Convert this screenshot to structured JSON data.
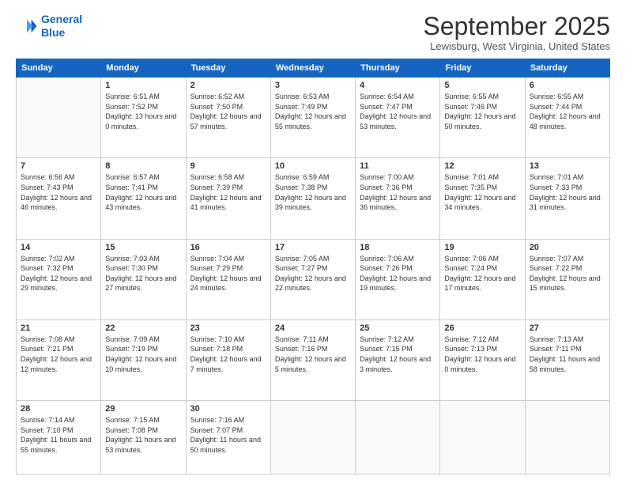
{
  "logo": {
    "line1": "General",
    "line2": "Blue"
  },
  "title": "September 2025",
  "location": "Lewisburg, West Virginia, United States",
  "days_header": [
    "Sunday",
    "Monday",
    "Tuesday",
    "Wednesday",
    "Thursday",
    "Friday",
    "Saturday"
  ],
  "weeks": [
    [
      {
        "day": "",
        "sunrise": "",
        "sunset": "",
        "daylight": ""
      },
      {
        "day": "1",
        "sunrise": "Sunrise: 6:51 AM",
        "sunset": "Sunset: 7:52 PM",
        "daylight": "Daylight: 13 hours and 0 minutes."
      },
      {
        "day": "2",
        "sunrise": "Sunrise: 6:52 AM",
        "sunset": "Sunset: 7:50 PM",
        "daylight": "Daylight: 12 hours and 57 minutes."
      },
      {
        "day": "3",
        "sunrise": "Sunrise: 6:53 AM",
        "sunset": "Sunset: 7:49 PM",
        "daylight": "Daylight: 12 hours and 55 minutes."
      },
      {
        "day": "4",
        "sunrise": "Sunrise: 6:54 AM",
        "sunset": "Sunset: 7:47 PM",
        "daylight": "Daylight: 12 hours and 53 minutes."
      },
      {
        "day": "5",
        "sunrise": "Sunrise: 6:55 AM",
        "sunset": "Sunset: 7:46 PM",
        "daylight": "Daylight: 12 hours and 50 minutes."
      },
      {
        "day": "6",
        "sunrise": "Sunrise: 6:55 AM",
        "sunset": "Sunset: 7:44 PM",
        "daylight": "Daylight: 12 hours and 48 minutes."
      }
    ],
    [
      {
        "day": "7",
        "sunrise": "Sunrise: 6:56 AM",
        "sunset": "Sunset: 7:43 PM",
        "daylight": "Daylight: 12 hours and 46 minutes."
      },
      {
        "day": "8",
        "sunrise": "Sunrise: 6:57 AM",
        "sunset": "Sunset: 7:41 PM",
        "daylight": "Daylight: 12 hours and 43 minutes."
      },
      {
        "day": "9",
        "sunrise": "Sunrise: 6:58 AM",
        "sunset": "Sunset: 7:39 PM",
        "daylight": "Daylight: 12 hours and 41 minutes."
      },
      {
        "day": "10",
        "sunrise": "Sunrise: 6:59 AM",
        "sunset": "Sunset: 7:38 PM",
        "daylight": "Daylight: 12 hours and 39 minutes."
      },
      {
        "day": "11",
        "sunrise": "Sunrise: 7:00 AM",
        "sunset": "Sunset: 7:36 PM",
        "daylight": "Daylight: 12 hours and 36 minutes."
      },
      {
        "day": "12",
        "sunrise": "Sunrise: 7:01 AM",
        "sunset": "Sunset: 7:35 PM",
        "daylight": "Daylight: 12 hours and 34 minutes."
      },
      {
        "day": "13",
        "sunrise": "Sunrise: 7:01 AM",
        "sunset": "Sunset: 7:33 PM",
        "daylight": "Daylight: 12 hours and 31 minutes."
      }
    ],
    [
      {
        "day": "14",
        "sunrise": "Sunrise: 7:02 AM",
        "sunset": "Sunset: 7:32 PM",
        "daylight": "Daylight: 12 hours and 29 minutes."
      },
      {
        "day": "15",
        "sunrise": "Sunrise: 7:03 AM",
        "sunset": "Sunset: 7:30 PM",
        "daylight": "Daylight: 12 hours and 27 minutes."
      },
      {
        "day": "16",
        "sunrise": "Sunrise: 7:04 AM",
        "sunset": "Sunset: 7:29 PM",
        "daylight": "Daylight: 12 hours and 24 minutes."
      },
      {
        "day": "17",
        "sunrise": "Sunrise: 7:05 AM",
        "sunset": "Sunset: 7:27 PM",
        "daylight": "Daylight: 12 hours and 22 minutes."
      },
      {
        "day": "18",
        "sunrise": "Sunrise: 7:06 AM",
        "sunset": "Sunset: 7:26 PM",
        "daylight": "Daylight: 12 hours and 19 minutes."
      },
      {
        "day": "19",
        "sunrise": "Sunrise: 7:06 AM",
        "sunset": "Sunset: 7:24 PM",
        "daylight": "Daylight: 12 hours and 17 minutes."
      },
      {
        "day": "20",
        "sunrise": "Sunrise: 7:07 AM",
        "sunset": "Sunset: 7:22 PM",
        "daylight": "Daylight: 12 hours and 15 minutes."
      }
    ],
    [
      {
        "day": "21",
        "sunrise": "Sunrise: 7:08 AM",
        "sunset": "Sunset: 7:21 PM",
        "daylight": "Daylight: 12 hours and 12 minutes."
      },
      {
        "day": "22",
        "sunrise": "Sunrise: 7:09 AM",
        "sunset": "Sunset: 7:19 PM",
        "daylight": "Daylight: 12 hours and 10 minutes."
      },
      {
        "day": "23",
        "sunrise": "Sunrise: 7:10 AM",
        "sunset": "Sunset: 7:18 PM",
        "daylight": "Daylight: 12 hours and 7 minutes."
      },
      {
        "day": "24",
        "sunrise": "Sunrise: 7:11 AM",
        "sunset": "Sunset: 7:16 PM",
        "daylight": "Daylight: 12 hours and 5 minutes."
      },
      {
        "day": "25",
        "sunrise": "Sunrise: 7:12 AM",
        "sunset": "Sunset: 7:15 PM",
        "daylight": "Daylight: 12 hours and 3 minutes."
      },
      {
        "day": "26",
        "sunrise": "Sunrise: 7:12 AM",
        "sunset": "Sunset: 7:13 PM",
        "daylight": "Daylight: 12 hours and 0 minutes."
      },
      {
        "day": "27",
        "sunrise": "Sunrise: 7:13 AM",
        "sunset": "Sunset: 7:11 PM",
        "daylight": "Daylight: 11 hours and 58 minutes."
      }
    ],
    [
      {
        "day": "28",
        "sunrise": "Sunrise: 7:14 AM",
        "sunset": "Sunset: 7:10 PM",
        "daylight": "Daylight: 11 hours and 55 minutes."
      },
      {
        "day": "29",
        "sunrise": "Sunrise: 7:15 AM",
        "sunset": "Sunset: 7:08 PM",
        "daylight": "Daylight: 11 hours and 53 minutes."
      },
      {
        "day": "30",
        "sunrise": "Sunrise: 7:16 AM",
        "sunset": "Sunset: 7:07 PM",
        "daylight": "Daylight: 11 hours and 50 minutes."
      },
      {
        "day": "",
        "sunrise": "",
        "sunset": "",
        "daylight": ""
      },
      {
        "day": "",
        "sunrise": "",
        "sunset": "",
        "daylight": ""
      },
      {
        "day": "",
        "sunrise": "",
        "sunset": "",
        "daylight": ""
      },
      {
        "day": "",
        "sunrise": "",
        "sunset": "",
        "daylight": ""
      }
    ]
  ]
}
